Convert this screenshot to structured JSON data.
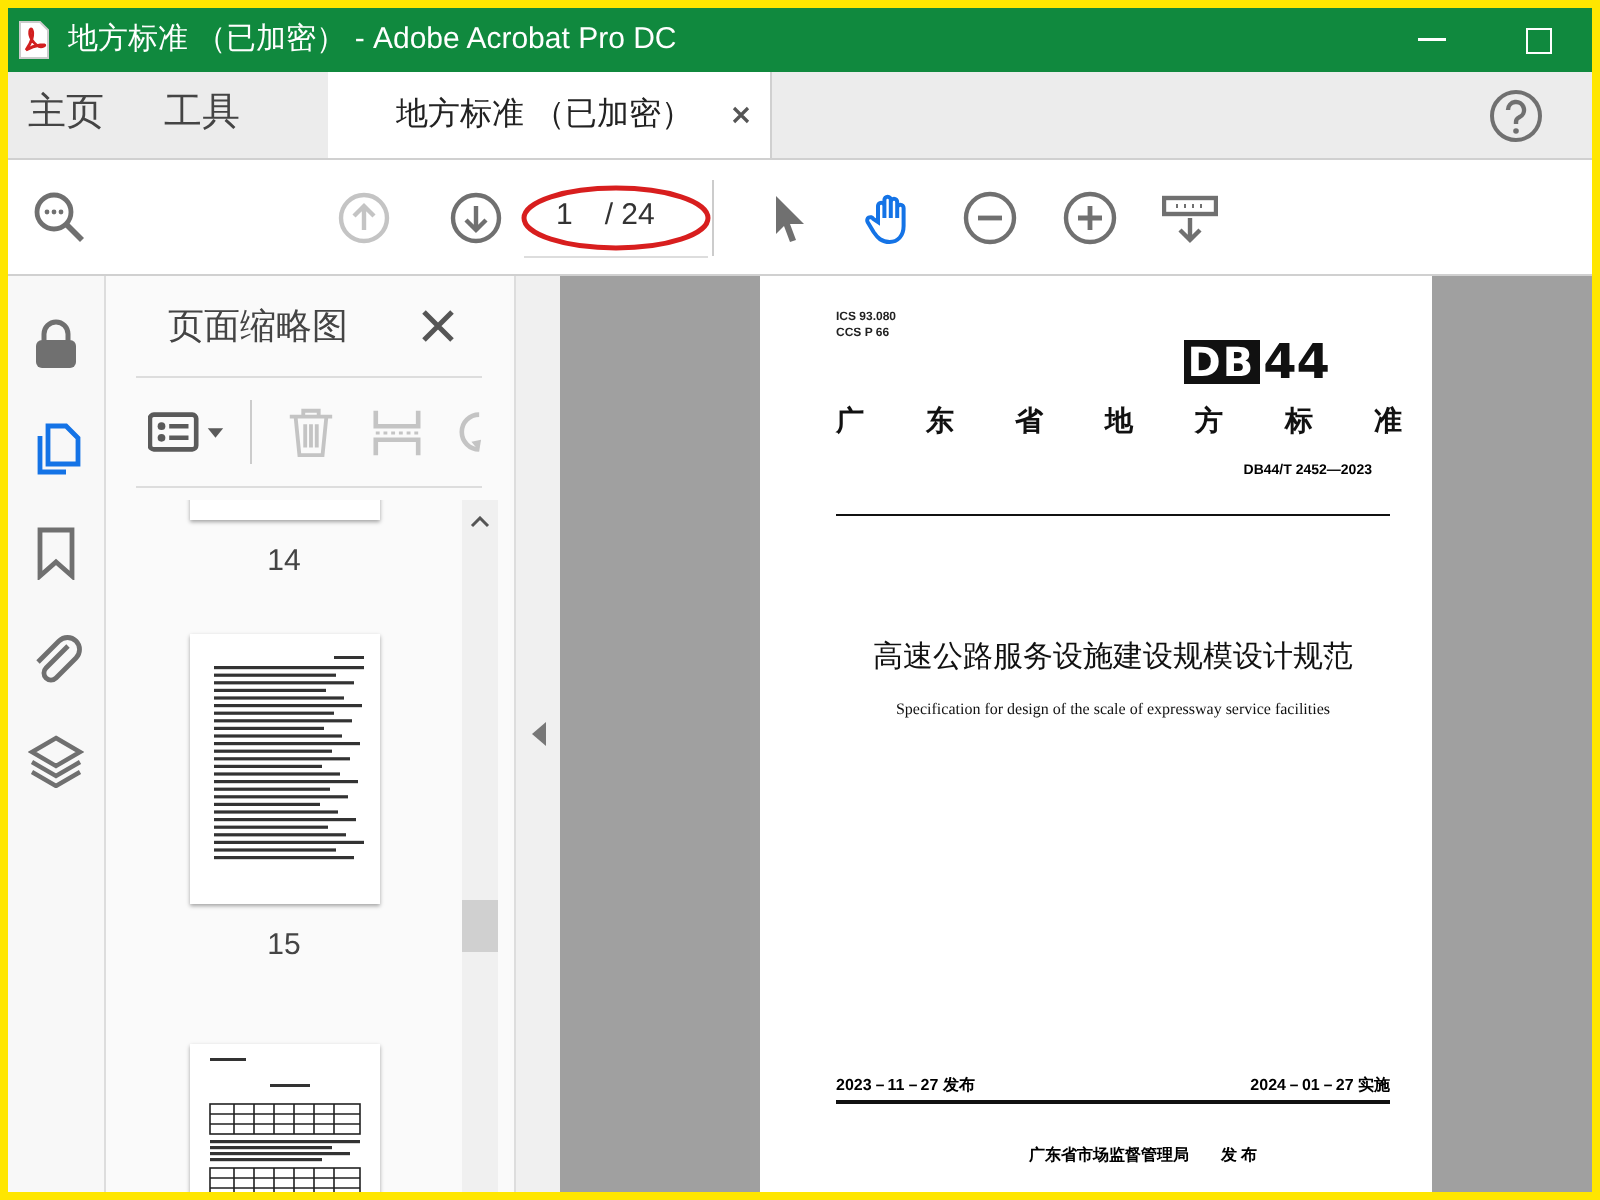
{
  "window": {
    "title": "地方标准 （已加密） - Adobe Acrobat Pro DC"
  },
  "tabs": [
    {
      "label": "主页",
      "selected": false
    },
    {
      "label": "工具",
      "selected": false
    },
    {
      "label": "地方标准 （已加密）",
      "selected": true
    }
  ],
  "toolbar": {
    "nav": [
      {
        "kind": "search",
        "disabled": false
      },
      {
        "kind": "prev",
        "disabled": true
      },
      {
        "kind": "next",
        "disabled": false
      }
    ],
    "page_number": "1",
    "page_total": "/ 24",
    "page_number_circled": true,
    "tools": [
      {
        "kind": "select",
        "selected": false
      },
      {
        "kind": "hand",
        "selected": true
      },
      {
        "kind": "zoom-out",
        "selected": false
      },
      {
        "kind": "zoom-in",
        "selected": false
      },
      {
        "kind": "scroll",
        "selected": false
      }
    ]
  },
  "left_rail": [
    {
      "kind": "lock",
      "selected": false
    },
    {
      "kind": "pages",
      "selected": true
    },
    {
      "kind": "bookmark",
      "selected": false
    },
    {
      "kind": "attachment",
      "selected": false
    },
    {
      "kind": "layers",
      "selected": false
    }
  ],
  "thumbnail_panel": {
    "title": "页面缩略图",
    "tools": [
      {
        "kind": "options",
        "disabled": false
      },
      {
        "kind": "delete",
        "disabled": true
      },
      {
        "kind": "extract",
        "disabled": true
      },
      {
        "kind": "rotate",
        "disabled": true
      }
    ],
    "thumbnails": [
      {
        "kind": "text-end",
        "label": "14"
      },
      {
        "kind": "text",
        "label": "15"
      },
      {
        "kind": "table"
      }
    ]
  },
  "document": {
    "ics": "ICS 93.080",
    "ccs": "CCS P 66",
    "code_mark": "DB",
    "code_number": "44",
    "category": "广 东 省 地 方 标 准",
    "standard_number": "DB44/T 2452—2023",
    "title": "高速公路服务设施建设规模设计规范",
    "subtitle": "Specification for design of the scale of expressway service facilities",
    "issue_date": "2023－11－27 发布",
    "effective_date": "2024－01－27 实施",
    "publisher": "广东省市场监督管理局　　发 布"
  }
}
